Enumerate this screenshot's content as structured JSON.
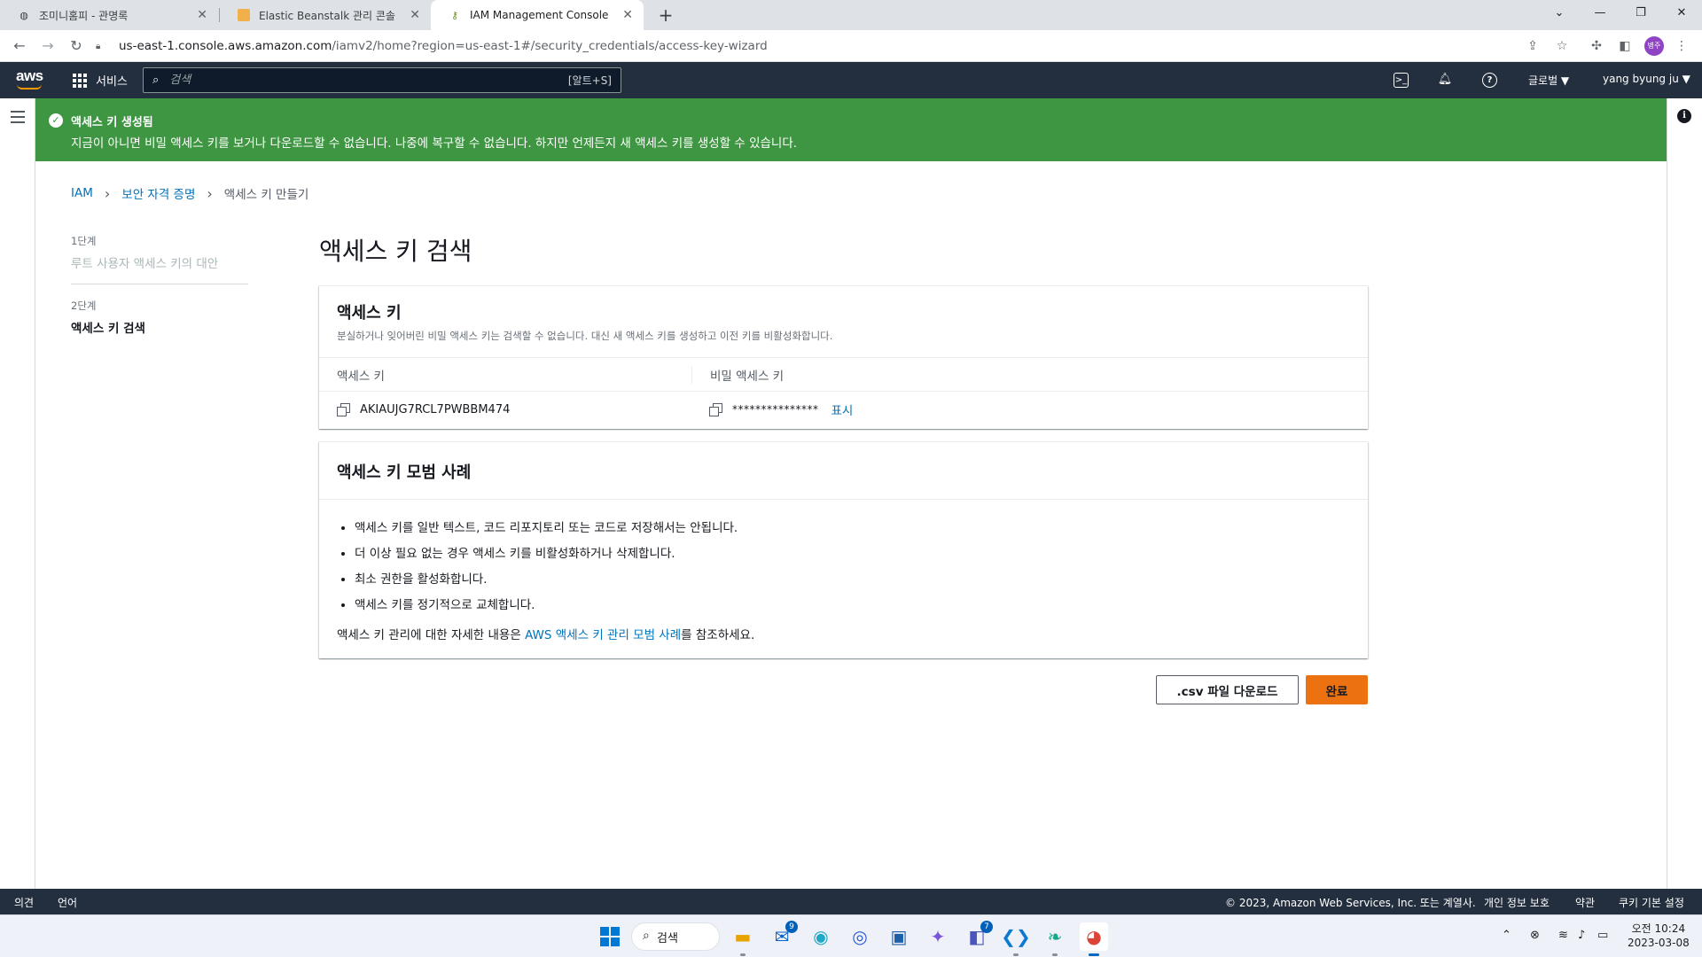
{
  "browser": {
    "tabs": [
      {
        "label": "조미니홈피 - 관명록",
        "icon": "globe-icon"
      },
      {
        "label": "Elastic Beanstalk 관리 콘솔",
        "icon": "aws-box-icon"
      },
      {
        "label": "IAM Management Console",
        "icon": "iam-key-icon",
        "active": true
      }
    ],
    "url_host": "us-east-1.console.aws.amazon.com",
    "url_path": "/iamv2/home?region=us-east-1#/security_credentials/access-key-wizard",
    "profile_initials": "병주"
  },
  "aws_nav": {
    "services_label": "서비스",
    "search_placeholder": "검색",
    "search_shortcut": "[알트+S]",
    "region_label": "글로벌 ▼",
    "account_label": "yang byung ju ▼"
  },
  "flash": {
    "title": "액세스 키 생성됨",
    "message": "지금이 아니면 비밀 액세스 키를 보거나 다운로드할 수 없습니다. 나중에 복구할 수 없습니다. 하지만 언제든지 새 액세스 키를 생성할 수 있습니다.",
    "color": "#3e9542"
  },
  "breadcrumb": {
    "items": [
      "IAM",
      "보안 자격 증명"
    ],
    "current": "액세스 키 만들기"
  },
  "steps": [
    {
      "label": "1단계",
      "name": "루트 사용자 액세스 키의 대안"
    },
    {
      "label": "2단계",
      "name": "액세스 키 검색"
    }
  ],
  "page_title": "액세스 키 검색",
  "access_key_card": {
    "title": "액세스 키",
    "description": "분실하거나 잊어버린 비밀 액세스 키는 검색할 수 없습니다. 대신 새 액세스 키를 생성하고 이전 키를 비활성화합니다.",
    "col_access_key": "액세스 키",
    "col_secret_key": "비밀 액세스 키",
    "access_key_value": "AKIAUJG7RCL7PWBBM474",
    "secret_key_masked": "***************",
    "show_link": "표시"
  },
  "best_practices_card": {
    "title": "액세스 키 모범 사례",
    "items": [
      "액세스 키를 일반 텍스트, 코드 리포지토리 또는 코드로 저장해서는 안됩니다.",
      "더 이상 필요 없는 경우 액세스 키를 비활성화하거나 삭제합니다.",
      "최소 권한을 활성화합니다.",
      "액세스 키를 정기적으로 교체합니다."
    ],
    "more_prefix": "액세스 키 관리에 대한 자세한 내용은 ",
    "more_link": "AWS 액세스 키 관리 모범 사례",
    "more_suffix": "를 참조하세요."
  },
  "actions": {
    "csv_label": ".csv 파일 다운로드",
    "done_label": "완료",
    "done_color": "#ec7211"
  },
  "footer": {
    "feedback": "의견",
    "language": "언어",
    "copyright": "© 2023, Amazon Web Services, Inc. 또는 계열사.",
    "privacy": "개인 정보 보호",
    "terms": "약관",
    "cookies": "쿠키 기본 설정"
  },
  "taskbar": {
    "search_label": "검색",
    "mail_badge": "9",
    "teams_badge": "7",
    "time": "오전 10:24",
    "date": "2023-03-08"
  }
}
